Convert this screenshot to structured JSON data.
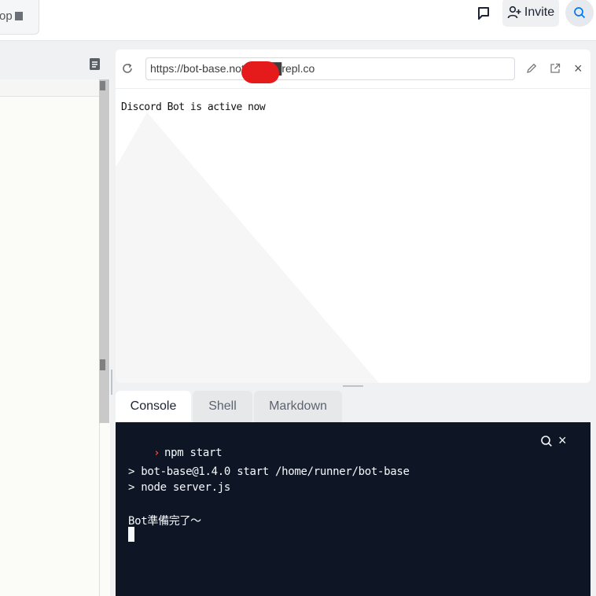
{
  "topbar": {
    "file_tab_label": "op",
    "invite_label": "Invite"
  },
  "webview": {
    "url": "https://bot-base.note████repl.co",
    "content": "Discord Bot is active now"
  },
  "tabs": [
    {
      "label": "Console",
      "active": true
    },
    {
      "label": "Shell",
      "active": false
    },
    {
      "label": "Markdown",
      "active": false
    }
  ],
  "console": {
    "command": "npm start",
    "lines": [
      "> bot-base@1.4.0 start /home/runner/bot-base",
      "> node server.js",
      "Bot準備完了～"
    ]
  },
  "icons": {
    "chat": "chat-icon",
    "invite": "add-user-icon",
    "search": "search-icon",
    "document": "document-icon",
    "reload": "reload-icon",
    "edit": "pencil-icon",
    "external": "external-link-icon",
    "close": "close-icon"
  },
  "colors": {
    "console_bg": "#0e1525",
    "prompt_accent": "#ff4a3d",
    "search_accent": "#0079f2",
    "redaction": "#e51b1b"
  }
}
